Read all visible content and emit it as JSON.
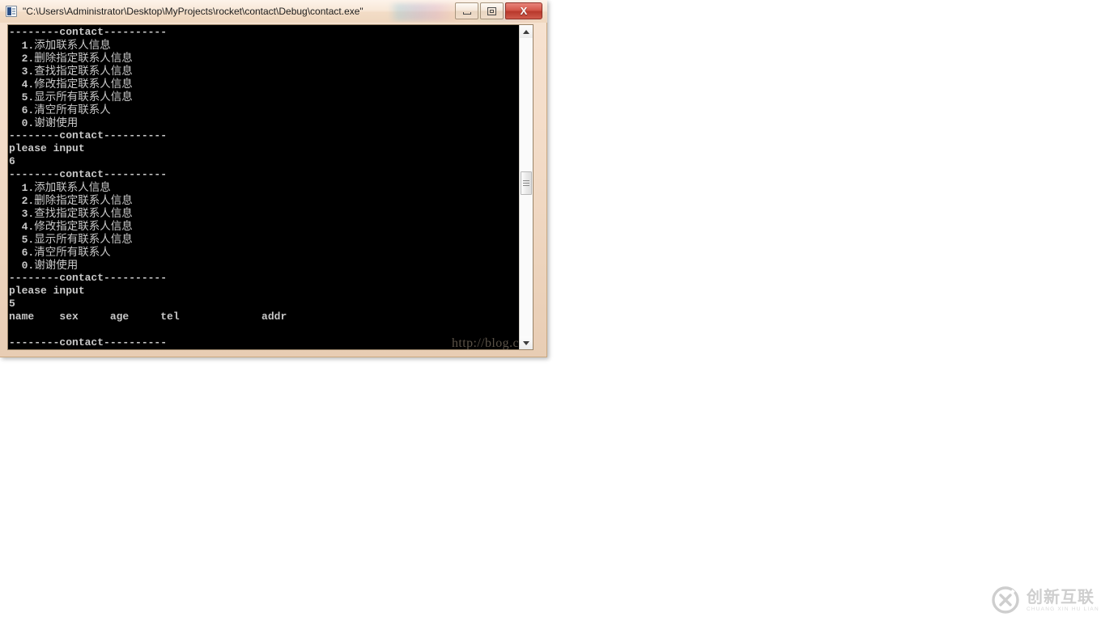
{
  "window": {
    "title": "\"C:\\Users\\Administrator\\Desktop\\MyProjects\\rocket\\contact\\Debug\\contact.exe\"",
    "icon_name": "console-app-icon",
    "buttons": {
      "minimize": "",
      "maximize": "",
      "close": "X"
    }
  },
  "terminal": {
    "lines": [
      "--------contact----------",
      "  1.添加联系人信息",
      "  2.删除指定联系人信息",
      "  3.查找指定联系人信息",
      "  4.修改指定联系人信息",
      "  5.显示所有联系人信息",
      "  6.清空所有联系人",
      "  0.谢谢使用",
      "--------contact----------",
      "please input",
      "6",
      "--------contact----------",
      "  1.添加联系人信息",
      "  2.删除指定联系人信息",
      "  3.查找指定联系人信息",
      "  4.修改指定联系人信息",
      "  5.显示所有联系人信息",
      "  6.清空所有联系人",
      "  0.谢谢使用",
      "--------contact----------",
      "please input",
      "5",
      "name    sex     age     tel             addr",
      "",
      "--------contact----------"
    ],
    "watermark": "http://blog.csdn.net/ret_skd"
  },
  "scrollbar": {
    "up_arrow": "scroll-up-arrow",
    "down_arrow": "scroll-down-arrow",
    "thumb": "scroll-thumb"
  },
  "brand": {
    "cn": "创新互联",
    "en": "CHUANG XIN HU LIAN"
  }
}
